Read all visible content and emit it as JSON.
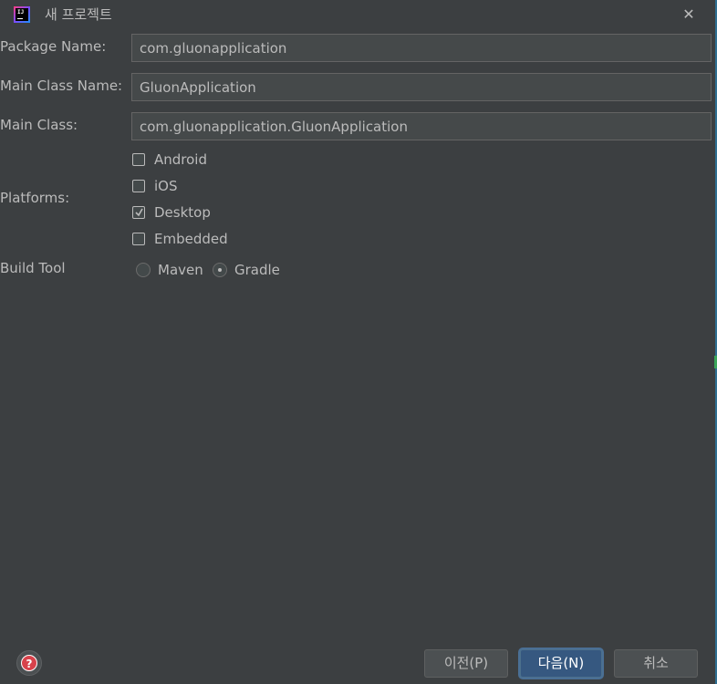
{
  "window": {
    "title": "새 프로젝트",
    "close_glyph": "✕",
    "app_icon_text": "IJ"
  },
  "form": {
    "package_name": {
      "label": "Package Name:",
      "value": "com.gluonapplication"
    },
    "main_class_name": {
      "label": "Main Class Name:",
      "value": "GluonApplication"
    },
    "main_class": {
      "label": "Main Class:",
      "value": "com.gluonapplication.GluonApplication"
    },
    "platforms": {
      "label": "Platforms:",
      "options": [
        {
          "label": "Android",
          "checked": false
        },
        {
          "label": "iOS",
          "checked": false
        },
        {
          "label": "Desktop",
          "checked": true
        },
        {
          "label": "Embedded",
          "checked": false
        }
      ]
    },
    "build_tool": {
      "label": "Build Tool",
      "options": [
        {
          "label": "Maven",
          "selected": false
        },
        {
          "label": "Gradle",
          "selected": true
        }
      ]
    }
  },
  "footer": {
    "help_glyph": "?",
    "previous_label": "이전(P)",
    "next_label": "다음(N)",
    "cancel_label": "취소"
  },
  "colors": {
    "background": "#3c3f41",
    "field_bg": "#45494a",
    "default_button": "#365880",
    "text": "#bbbbbb"
  }
}
